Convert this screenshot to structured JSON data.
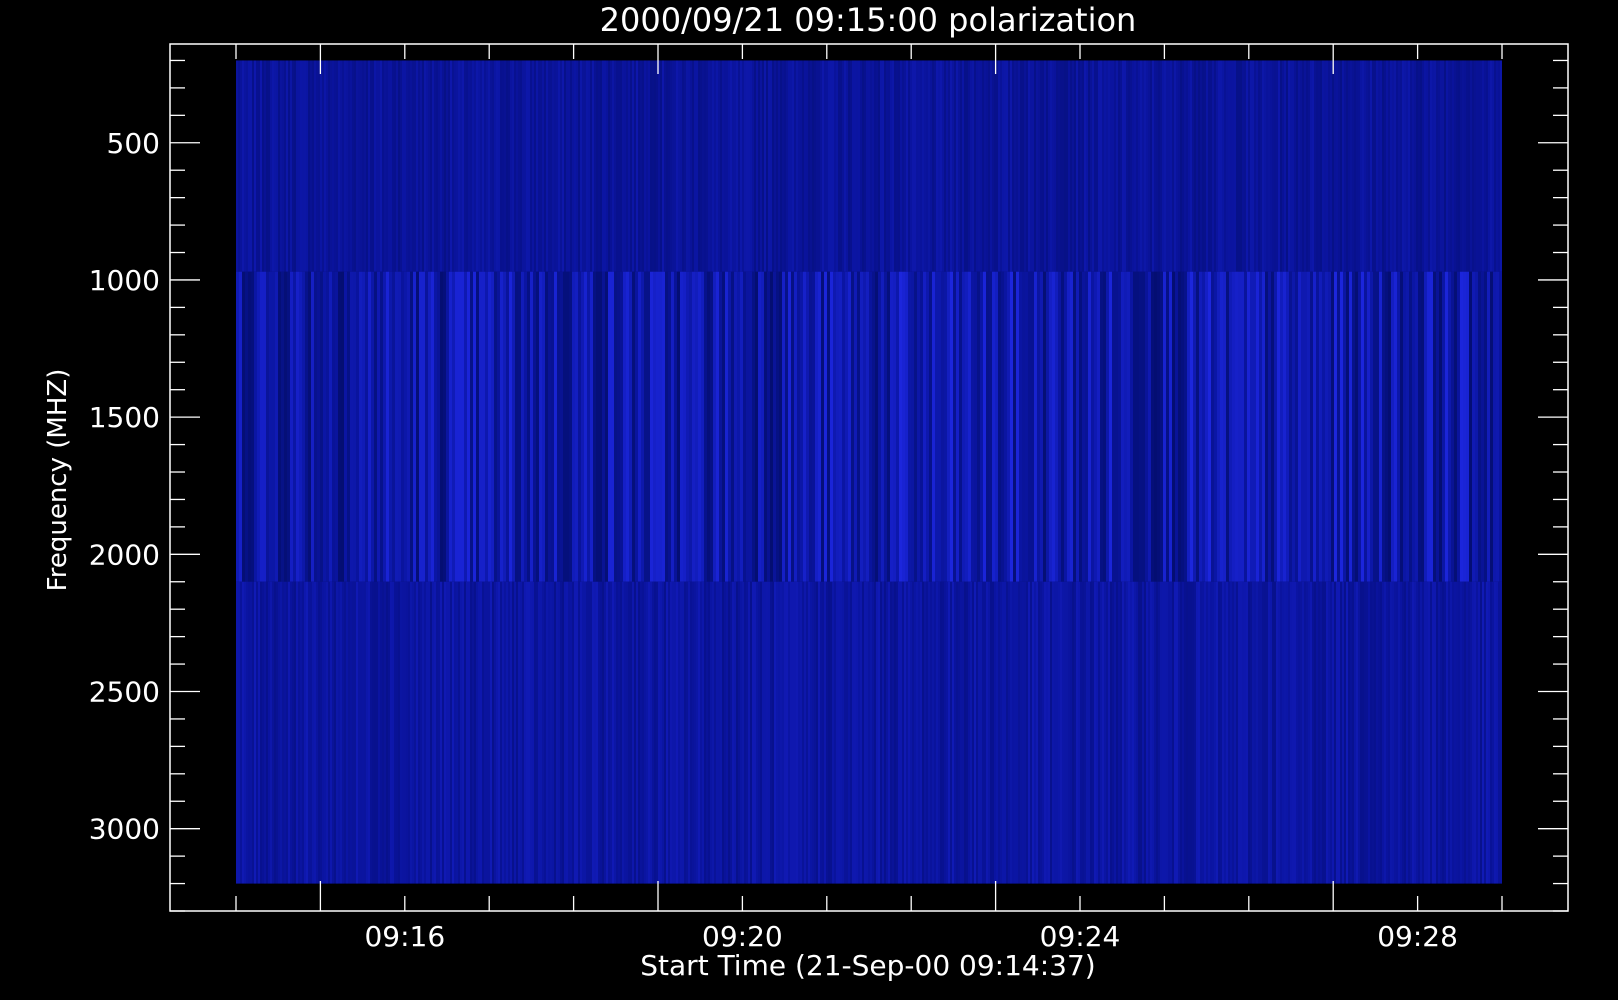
{
  "chart_data": {
    "type": "heatmap",
    "title": "2000/09/21 09:15:00 polarization",
    "xlabel": "Start Time (21-Sep-00 09:14:37)",
    "ylabel": "Frequency (MHZ)",
    "x_ticks": [
      "09:16",
      "09:20",
      "09:24",
      "09:28"
    ],
    "y_ticks": [
      500,
      1000,
      1500,
      2000,
      2500,
      3000
    ],
    "ylim": [
      3300,
      140
    ],
    "x_range_min_from_start": [
      0,
      15
    ],
    "data_extent": {
      "time": [
        "09:14:37",
        "09:29:37"
      ],
      "frequency_mhz": [
        200,
        3200
      ]
    },
    "bands": [
      {
        "freq_range": [
          200,
          970
        ],
        "level": 0.45,
        "texture": "smooth"
      },
      {
        "freq_range": [
          970,
          2100
        ],
        "level": 0.55,
        "texture": "striated"
      },
      {
        "freq_range": [
          2100,
          3200
        ],
        "level": 0.5,
        "texture": "fine"
      }
    ],
    "colors": {
      "background": "#000000",
      "axes": "#ffffff",
      "dark": "#000a5a",
      "mid": "#0a14a0",
      "bright": "#1e28e6"
    }
  }
}
